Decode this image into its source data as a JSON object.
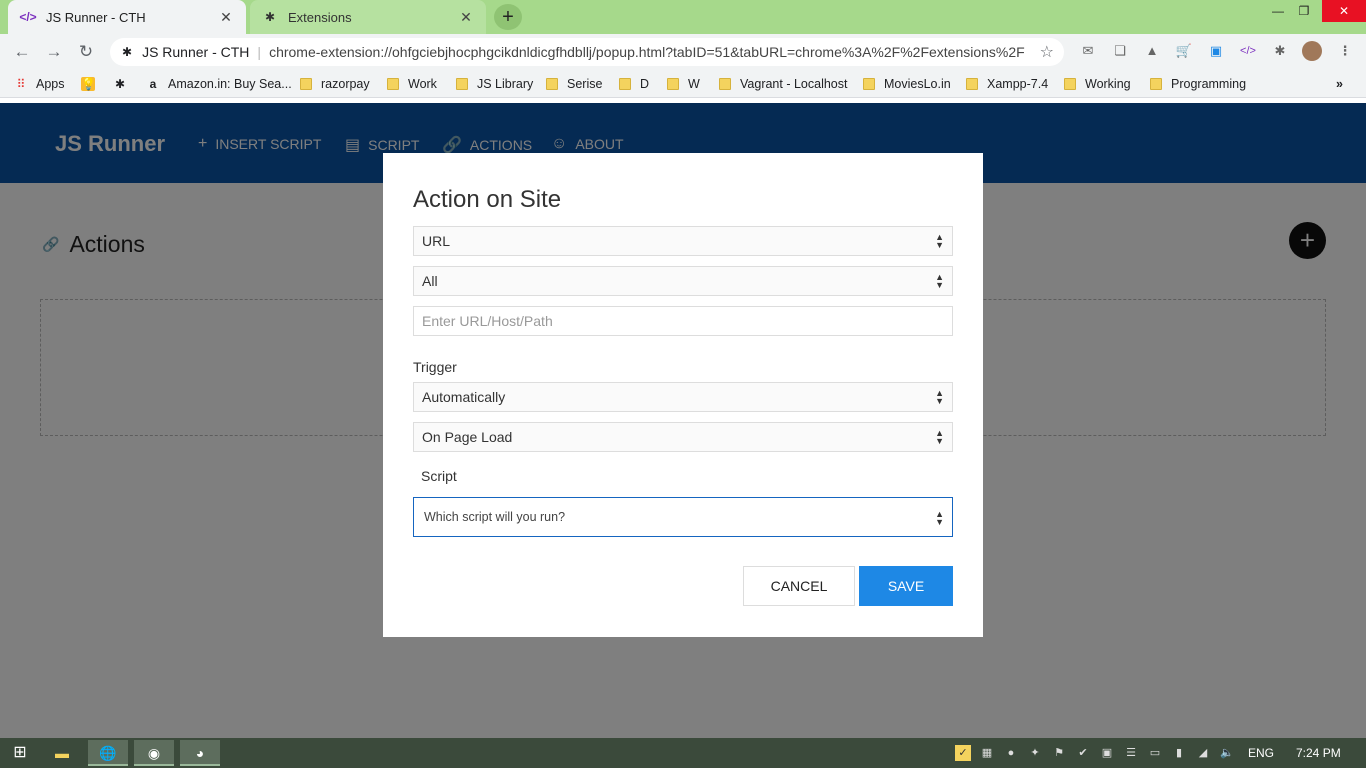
{
  "browser": {
    "tabs": [
      {
        "label": "JS Runner - CTH",
        "icon": "code-icon",
        "active": true
      },
      {
        "label": "Extensions",
        "icon": "puzzle-icon",
        "active": false
      }
    ],
    "address": {
      "site_chip": "JS Runner - CTH",
      "url": "chrome-extension://ohfgciebjhocphgcikdnldicgfhdbllj/popup.html?tabID=51&tabURL=chrome%3A%2F%2Fextensions%2F"
    },
    "bookmarks": [
      {
        "label": "Apps",
        "icon": "apps-grid-icon"
      },
      {
        "label": "",
        "icon": "keep-icon"
      },
      {
        "label": "",
        "icon": "puzzle-icon"
      },
      {
        "label": "Amazon.in: Buy Sea...",
        "icon": "amazon-icon"
      },
      {
        "label": "razorpay",
        "icon": "folder-icon"
      },
      {
        "label": "Work",
        "icon": "folder-icon"
      },
      {
        "label": "JS Library",
        "icon": "folder-icon"
      },
      {
        "label": "Serise",
        "icon": "folder-icon"
      },
      {
        "label": "D",
        "icon": "folder-icon"
      },
      {
        "label": "W",
        "icon": "folder-icon"
      },
      {
        "label": "Vagrant - Localhost",
        "icon": "folder-icon"
      },
      {
        "label": "MoviesLo.in",
        "icon": "folder-icon"
      },
      {
        "label": "Xampp-7.4",
        "icon": "folder-icon"
      },
      {
        "label": "Working",
        "icon": "folder-icon"
      },
      {
        "label": "Programming",
        "icon": "folder-icon"
      }
    ]
  },
  "app": {
    "brand": "JS Runner",
    "nav": [
      {
        "label": "INSERT SCRIPT",
        "icon": "plus-icon"
      },
      {
        "label": "SCRIPT",
        "icon": "document-icon"
      },
      {
        "label": "ACTIONS",
        "icon": "link-icon"
      },
      {
        "label": "ABOUT",
        "icon": "smiley-icon"
      }
    ],
    "section_title": "Actions"
  },
  "dialog": {
    "title": "Action on Site",
    "match_type": "URL",
    "match_scope": "All",
    "url_placeholder": "Enter URL/Host/Path",
    "trigger_label": "Trigger",
    "trigger_mode": "Automatically",
    "trigger_event": "On Page Load",
    "script_label": "Script",
    "script_placeholder": "Which script will you run?",
    "cancel_label": "CANCEL",
    "save_label": "SAVE"
  },
  "taskbar": {
    "language": "ENG",
    "time": "7:24 PM"
  }
}
